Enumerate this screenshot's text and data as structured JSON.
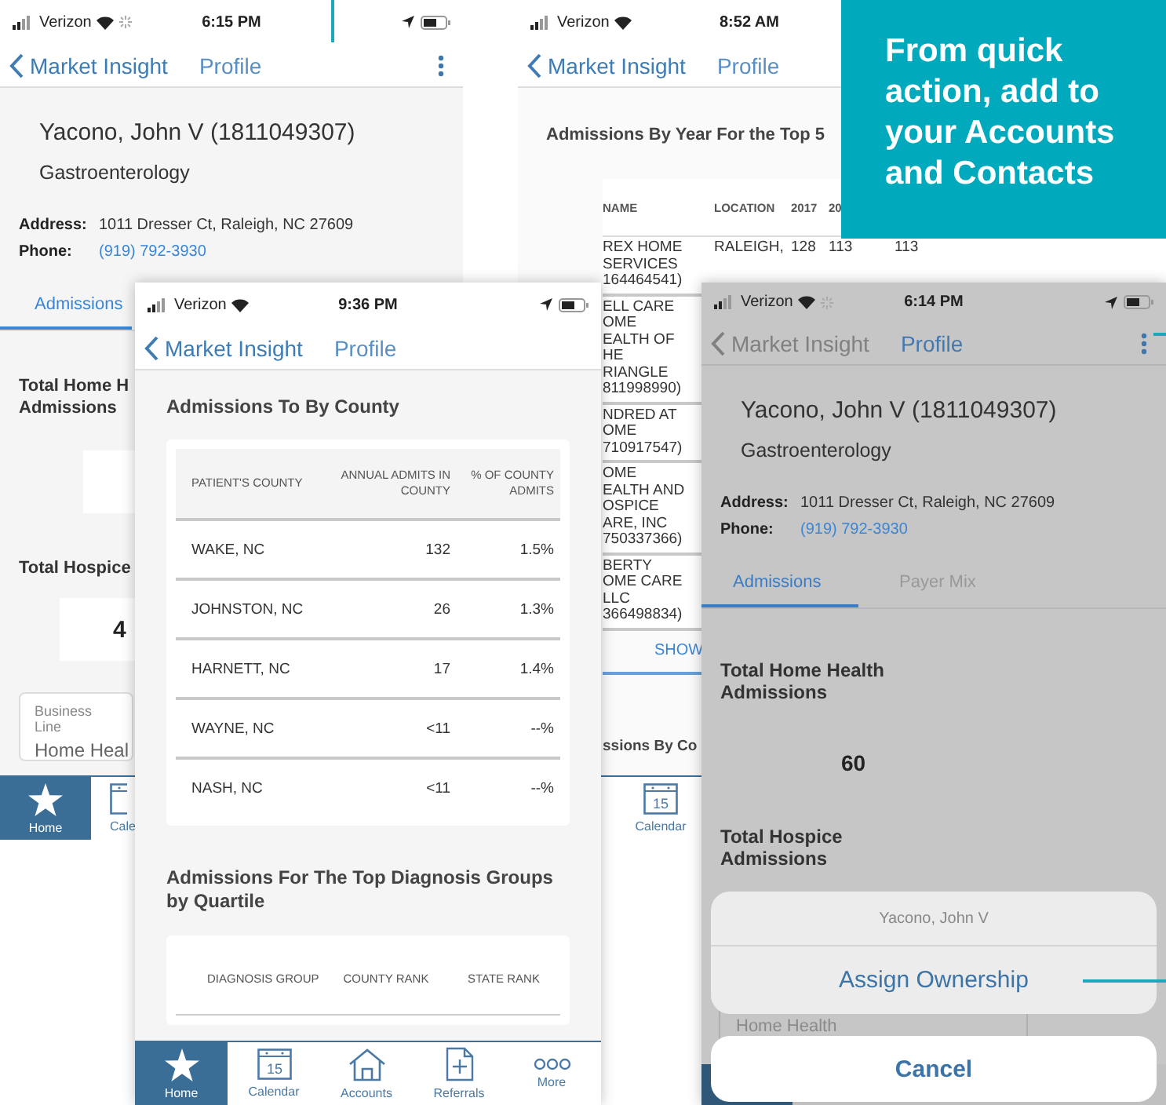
{
  "back_profile_screen": {
    "status": {
      "carrier": "Verizon",
      "time": "6:15 PM",
      "loading": true
    },
    "nav": {
      "back": "Market Insight",
      "title": "Profile",
      "menu": true
    },
    "name": "Yacono, John V (1811049307)",
    "specialty": "Gastroenterology",
    "details": [
      {
        "label": "Address:",
        "value": "1011 Dresser Ct, Raleigh, NC 27609",
        "kind": "text"
      },
      {
        "label": "Phone:",
        "value": "(919) 792-3930",
        "kind": "link"
      }
    ],
    "tabs": [
      {
        "label": "Admissions",
        "selected": true
      }
    ],
    "stats": [
      {
        "title_lines": [
          "Total Home H",
          "Admissions"
        ]
      },
      {
        "title_lines": [
          "Total Hospice"
        ],
        "value": "4"
      }
    ],
    "field": {
      "label": "Business Line",
      "value": "Home Heal"
    },
    "tab_bar": [
      {
        "label": "Home",
        "selected": true
      },
      {
        "label": "Cale",
        "selected": false
      }
    ]
  },
  "hospital_screen": {
    "status": {
      "carrier": "Verizon",
      "time": "8:52 AM"
    },
    "nav": {
      "back": "Market Insight",
      "title": "Profile"
    },
    "heading": "Admissions By Year For the Top 5",
    "columns": [
      "NAME",
      "LOCATION",
      "2017",
      "20"
    ],
    "rows": [
      {
        "name_lines": [
          "REX HOME",
          "SERVICES",
          "164464541)"
        ],
        "cells": [
          "RALEIGH,",
          "128",
          "113",
          "113"
        ]
      },
      {
        "name_lines": [
          "ELL CARE",
          "OME",
          "EALTH OF",
          "HE",
          "RIANGLE",
          "811998990)"
        ]
      },
      {
        "name_lines": [
          "NDRED AT",
          "OME",
          "710917547)"
        ]
      },
      {
        "name_lines": [
          "OME",
          "EALTH AND",
          "OSPICE",
          "ARE, INC",
          "750337366)"
        ]
      },
      {
        "name_lines": [
          "BERTY",
          "OME CARE",
          "LLC",
          "366498834)"
        ]
      }
    ],
    "link": "SHOW",
    "next_heading": "ssions By Co",
    "tab_bar": [
      {
        "label": "Calendar",
        "icon_text": "15",
        "selected": false
      }
    ]
  },
  "county_screen": {
    "status": {
      "carrier": "Verizon",
      "time": "9:36 PM"
    },
    "nav": {
      "back": "Market Insight",
      "title": "Profile"
    },
    "heading": "Admissions To By County",
    "columns": [
      "PATIENT'S COUNTY",
      "ANNUAL ADMITS IN COUNTY",
      "% OF COUNTY ADMITS"
    ],
    "rows": [
      [
        "WAKE, NC",
        "132",
        "1.5%"
      ],
      [
        "JOHNSTON, NC",
        "26",
        "1.3%"
      ],
      [
        "HARNETT, NC",
        "17",
        "1.4%"
      ],
      [
        "WAYNE, NC",
        "<11",
        "--%"
      ],
      [
        "NASH, NC",
        "<11",
        "--%"
      ]
    ],
    "heading2": "Admissions For The Top Diagnosis Groups by Quartile",
    "columns2": [
      "DIAGNOSIS GROUP",
      "COUNTY RANK",
      "STATE RANK"
    ],
    "tab_bar": [
      {
        "label": "Home",
        "selected": true
      },
      {
        "label": "Calendar",
        "icon_text": "15",
        "selected": false
      },
      {
        "label": "Accounts",
        "selected": false
      },
      {
        "label": "Referrals",
        "selected": false
      },
      {
        "label": "More",
        "selected": false
      }
    ]
  },
  "action_screen": {
    "status": {
      "carrier": "Verizon",
      "time": "6:14 PM",
      "loading": true
    },
    "nav": {
      "back": "Market Insight",
      "title": "Profile",
      "menu": true
    },
    "name": "Yacono, John V (1811049307)",
    "specialty": "Gastroenterology",
    "details": [
      {
        "label": "Address:",
        "value": "1011 Dresser Ct, Raleigh, NC 27609",
        "kind": "text"
      },
      {
        "label": "Phone:",
        "value": "(919) 792-3930",
        "kind": "link"
      }
    ],
    "tabs": [
      {
        "label": "Admissions",
        "selected": true
      },
      {
        "label": "Payer Mix",
        "selected": false
      }
    ],
    "stats": [
      {
        "title": "Total Home Health Admissions",
        "value": "60"
      },
      {
        "title": "Total Hospice Admissions"
      }
    ],
    "field_value": "Home Health",
    "sheet": {
      "title": "Yacono, John V",
      "actions": [
        "Assign Ownership"
      ],
      "cancel": "Cancel"
    }
  },
  "callout": {
    "text": "From quick action, add to your Accounts and Contacts"
  }
}
